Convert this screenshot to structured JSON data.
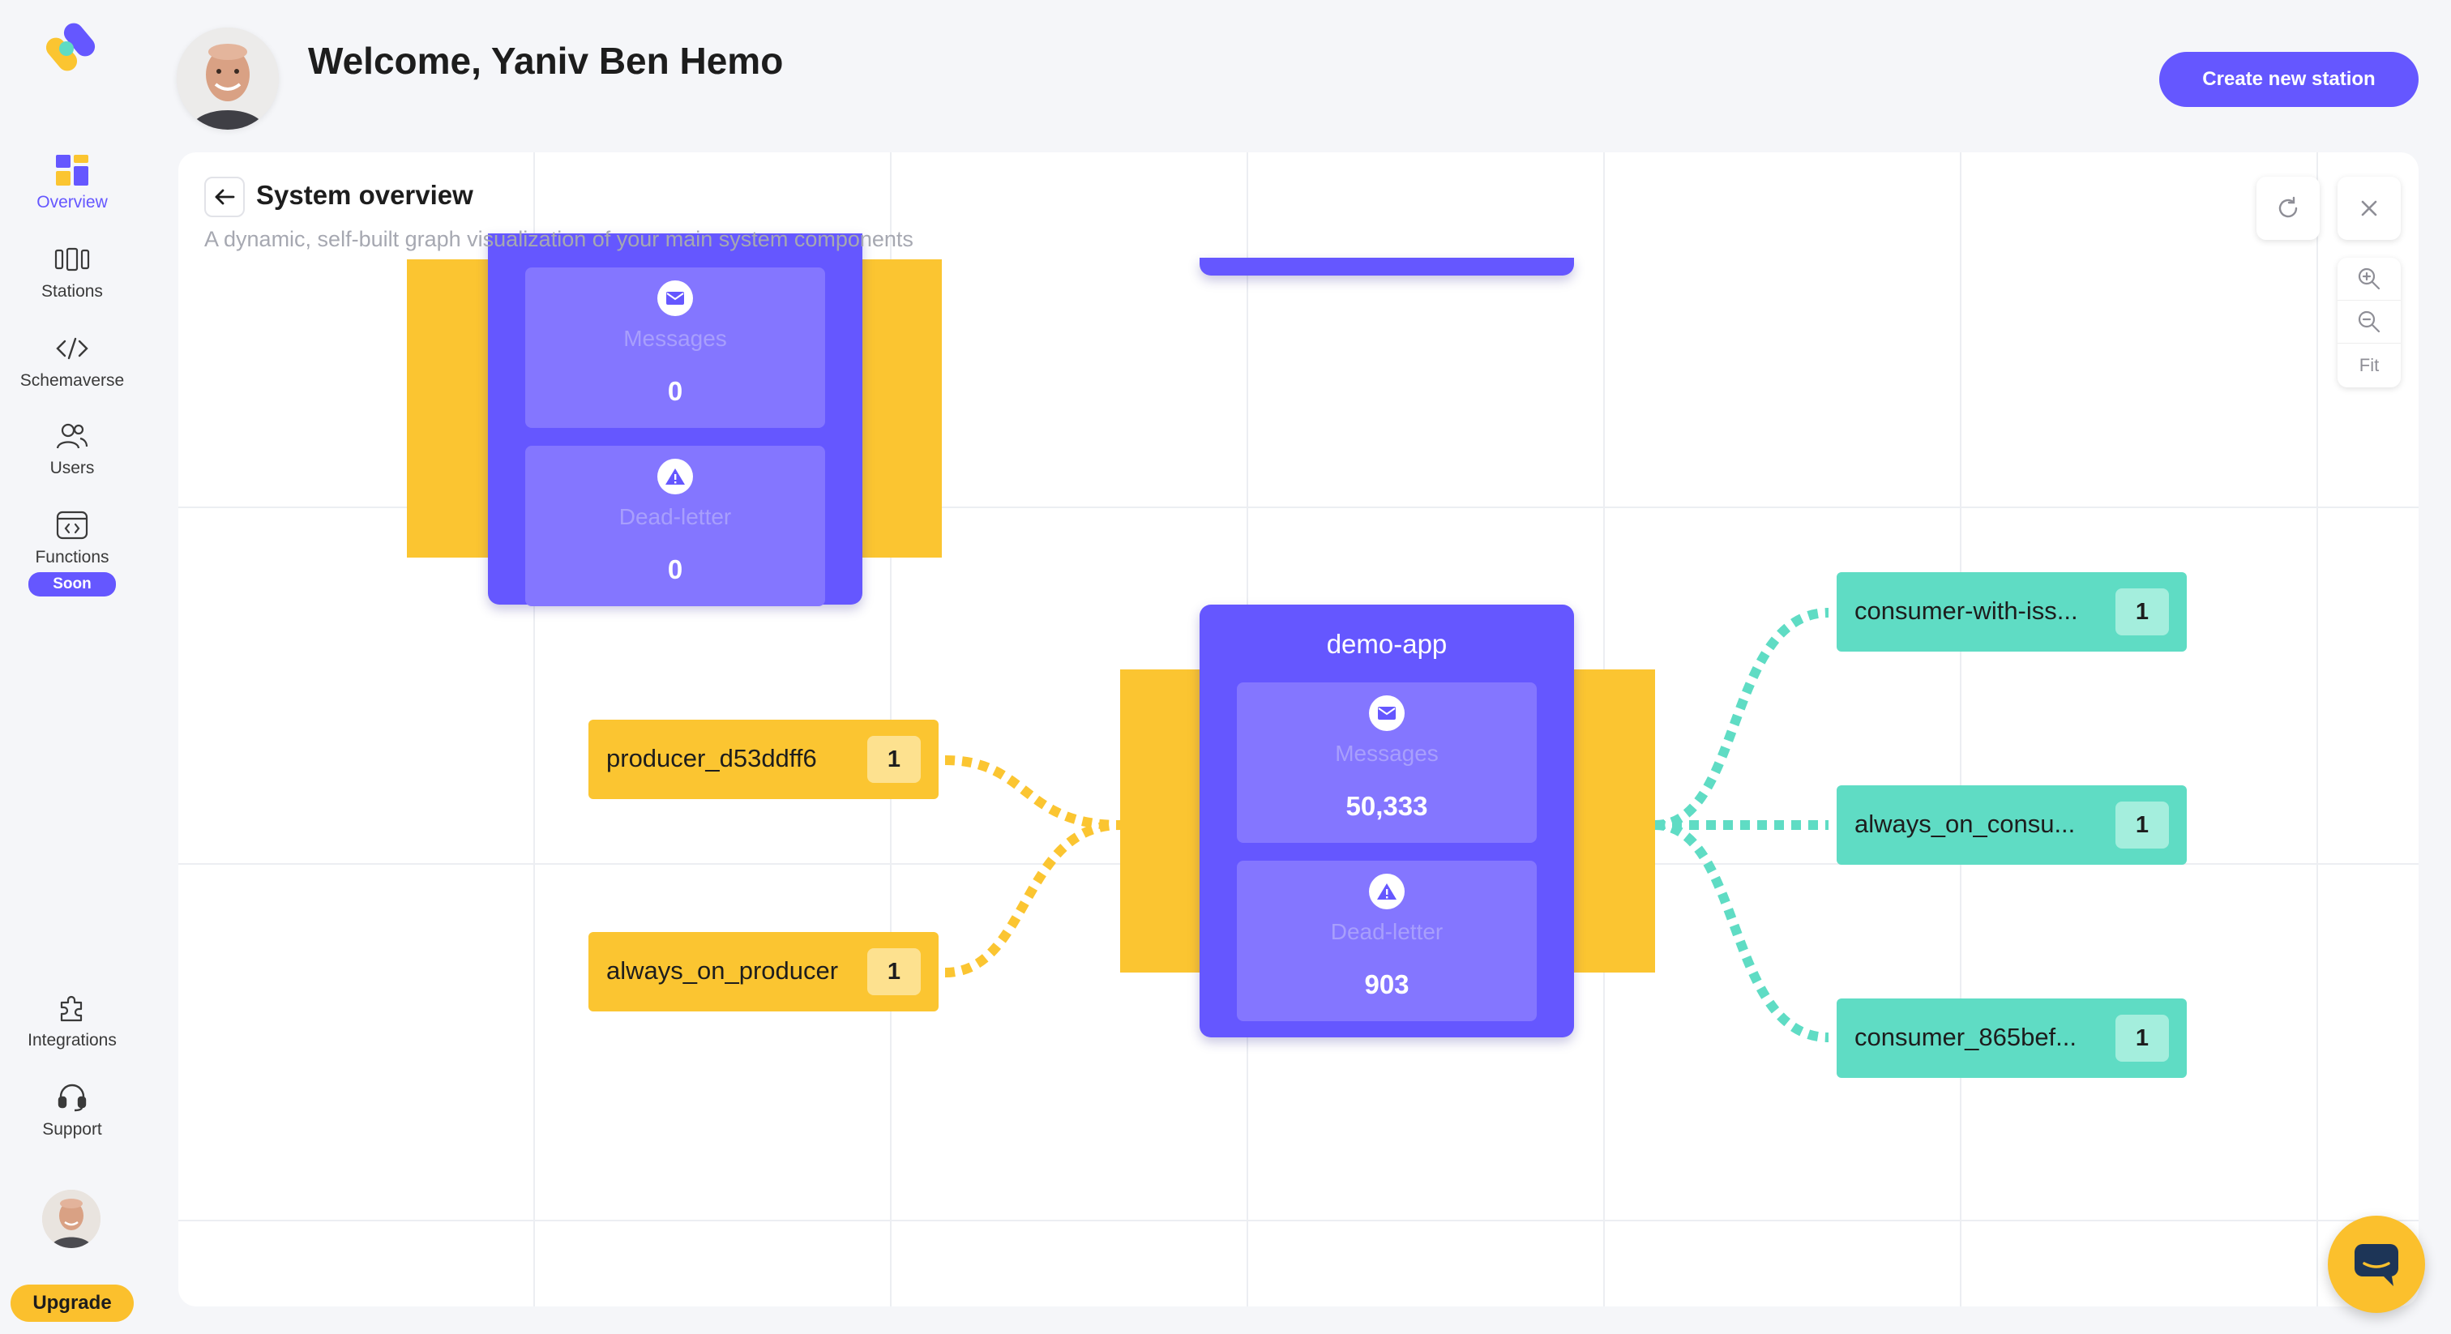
{
  "sidebar": {
    "items": [
      {
        "label": "Overview",
        "icon": "overview-icon",
        "active": true
      },
      {
        "label": "Stations",
        "icon": "stations-icon"
      },
      {
        "label": "Schemaverse",
        "icon": "code-icon"
      },
      {
        "label": "Users",
        "icon": "users-icon"
      },
      {
        "label": "Functions",
        "icon": "functions-icon",
        "badge": "Soon"
      }
    ],
    "bottom_items": [
      {
        "label": "Integrations",
        "icon": "puzzle-icon"
      },
      {
        "label": "Support",
        "icon": "headset-icon"
      }
    ],
    "upgrade_label": "Upgrade"
  },
  "header": {
    "welcome": "Welcome, Yaniv Ben Hemo",
    "create_station_label": "Create new station"
  },
  "overview": {
    "title": "System overview",
    "subtitle": "A dynamic, self-built graph visualization of your main system components",
    "fit_label": "Fit"
  },
  "graph": {
    "top_station": {
      "messages_label": "Messages",
      "messages_value": "0",
      "deadletter_label": "Dead-letter",
      "deadletter_value": "0"
    },
    "main_station": {
      "name": "demo-app",
      "messages_label": "Messages",
      "messages_value": "50,333",
      "deadletter_label": "Dead-letter",
      "deadletter_value": "903"
    },
    "producers": [
      {
        "name": "producer_d53ddff6",
        "count": "1"
      },
      {
        "name": "always_on_producer",
        "count": "1"
      }
    ],
    "consumers": [
      {
        "name": "consumer-with-iss...",
        "count": "1"
      },
      {
        "name": "always_on_consu...",
        "count": "1"
      },
      {
        "name": "consumer_865bef...",
        "count": "1"
      }
    ]
  },
  "colors": {
    "accent": "#6557ff",
    "producer": "#fbc531",
    "consumer": "#5fdcc4",
    "upgrade": "#fbc02d"
  }
}
